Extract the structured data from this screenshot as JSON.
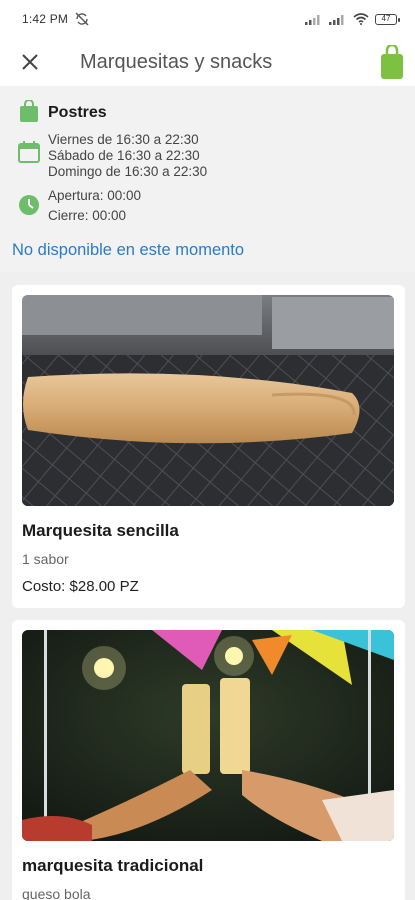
{
  "status_bar": {
    "time": "1:42 PM",
    "battery": "47"
  },
  "app_bar": {
    "title": "Marquesitas y snacks",
    "close_icon": "close-icon",
    "bag_icon": "shopping-bag-icon"
  },
  "store_info": {
    "category": "Postres",
    "schedule": [
      "Viernes de 16:30 a 22:30",
      "Sábado de 16:30 a 22:30",
      "Domingo de 16:30 a 22:30"
    ],
    "opening": "Apertura: 00:00",
    "closing": "Cierre: 00:00",
    "availability": "No disponible en este momento"
  },
  "products": [
    {
      "name": "Marquesita sencilla",
      "description": "1 sabor",
      "price": "Costo: $28.00 PZ"
    },
    {
      "name": "marquesita tradicional",
      "description": "queso bola"
    }
  ],
  "colors": {
    "accent_green": "#7cc142",
    "link_blue": "#2a7bc9",
    "icon_green": "#6dbd6b"
  }
}
